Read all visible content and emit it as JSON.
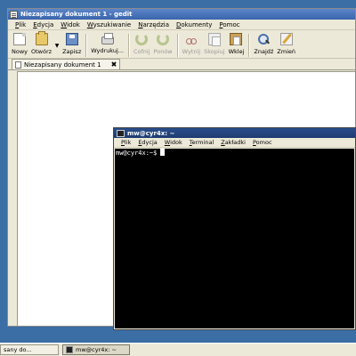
{
  "gedit": {
    "title": "Niezapisany dokument 1 - gedit",
    "menu": [
      "Plik",
      "Edycja",
      "Widok",
      "Wyszukiwanie",
      "Narzędzia",
      "Dokumenty",
      "Pomoc"
    ],
    "toolbar": {
      "new": "Nowy",
      "open": "Otwórz",
      "save": "Zapisz",
      "print": "Wydrukuj...",
      "undo": "Cofnij",
      "redo": "Ponów",
      "cut": "Wytnij",
      "copy": "Skopiuj",
      "paste": "Wklej",
      "find": "Znajdź",
      "replace": "Zmień"
    },
    "tab_label": "Niezapisany dokument 1",
    "tab_close": "✖"
  },
  "terminal": {
    "title": "mw@cyr4x: ~",
    "menu": [
      "Plik",
      "Edycja",
      "Widok",
      "Terminal",
      "Zakładki",
      "Pomoc"
    ],
    "prompt": "mw@cyr4x:~$"
  },
  "taskbar": {
    "items": [
      "sany do...",
      "mw@cyr4x: ~"
    ]
  }
}
